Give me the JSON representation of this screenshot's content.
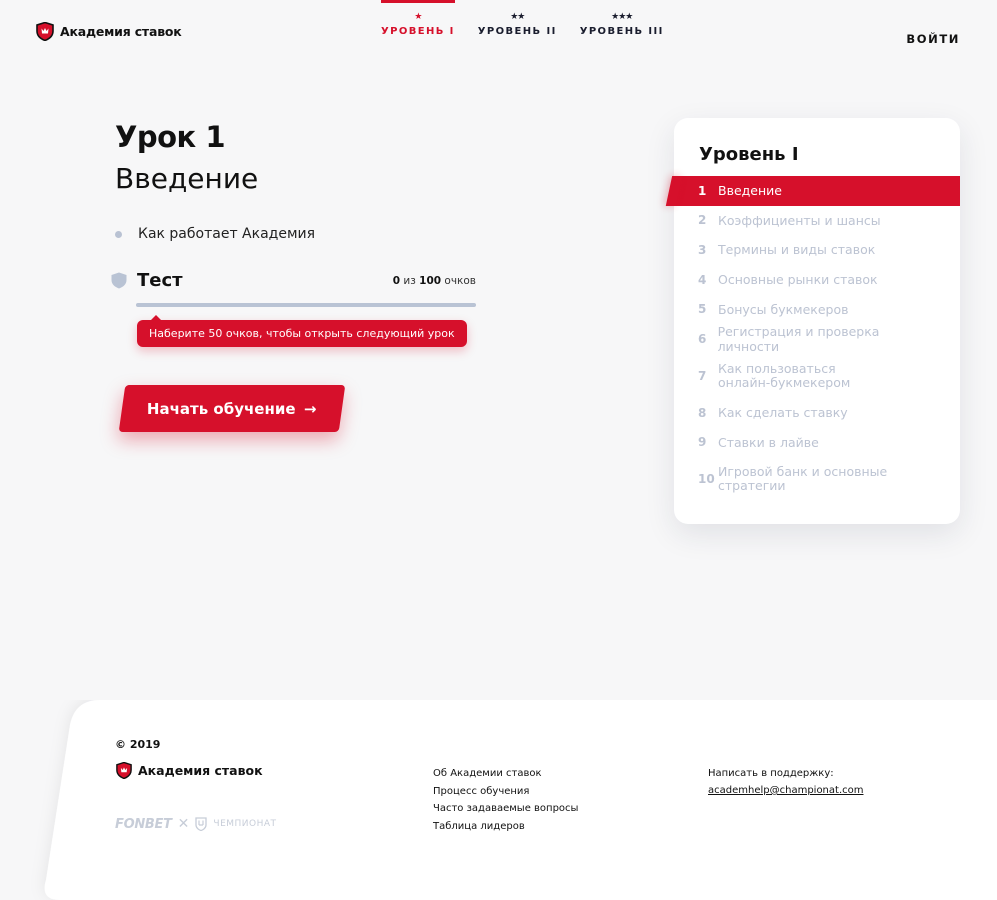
{
  "header": {
    "brand": "Академия ставок",
    "levels": [
      {
        "stars": "★",
        "label": "УРОВЕНЬ I",
        "active": true
      },
      {
        "stars": "★★",
        "label": "УРОВЕНЬ II",
        "active": false
      },
      {
        "stars": "★★★",
        "label": "УРОВЕНЬ III",
        "active": false
      }
    ],
    "login_label": "ВОЙТИ"
  },
  "lesson": {
    "number": "Урок 1",
    "title": "Введение",
    "topics": [
      "Как работает Академия"
    ],
    "test": {
      "title": "Тест",
      "score": "0",
      "score_of": "из",
      "score_max": "100",
      "score_unit": "очков",
      "progress": 0,
      "hint": "Наберите 50 очков, чтобы открыть следующий урок"
    },
    "start_label": "Начать обучение",
    "start_arrow": "→"
  },
  "sidebar": {
    "title": "Уровень I",
    "lessons": [
      {
        "num": "1",
        "label": "Введение",
        "active": true
      },
      {
        "num": "2",
        "label": "Коэффициенты и шансы"
      },
      {
        "num": "3",
        "label": "Термины и виды ставок"
      },
      {
        "num": "4",
        "label": "Основные рынки ставок"
      },
      {
        "num": "5",
        "label": "Бонусы букмекеров"
      },
      {
        "num": "6",
        "label": "Регистрация и проверка личности"
      },
      {
        "num": "7",
        "label": "Как пользоваться онлайн-букмекером"
      },
      {
        "num": "8",
        "label": "Как сделать ставку"
      },
      {
        "num": "9",
        "label": "Ставки в лайве"
      },
      {
        "num": "10",
        "label": "Игровой банк и основные стратегии"
      }
    ]
  },
  "footer": {
    "copyright": "© 2019",
    "brand": "Академия ставок",
    "partner_1": "FONBET",
    "partner_sep": "✕",
    "partner_2": "ЧЕМПИОНАТ",
    "links": [
      "Об Академии ставок",
      "Процесс обучения",
      "Часто задаваемые вопросы",
      "Таблица лидеров"
    ],
    "support_label": "Написать в поддержку:",
    "support_email": "academhelp@championat.com"
  },
  "colors": {
    "accent": "#d6102b",
    "muted": "#bcc3d2",
    "background": "#f7f7f8"
  }
}
